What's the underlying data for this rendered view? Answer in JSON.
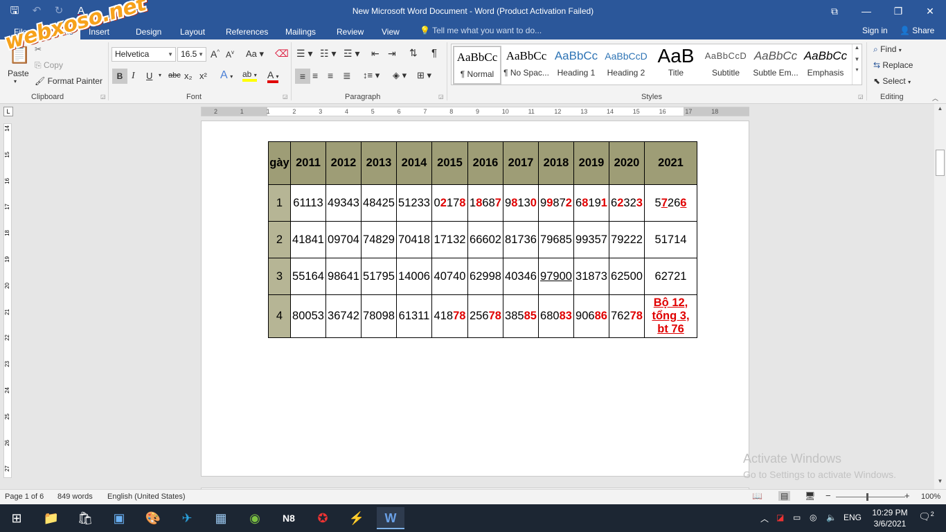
{
  "window": {
    "title": "New Microsoft Word Document  -  Word (Product Activation Failed)",
    "controls": [
      "restore-ribbon",
      "minimize",
      "maximize",
      "close"
    ]
  },
  "qat": {
    "text_icon": "A"
  },
  "tabs": [
    "File",
    "Home",
    "Insert",
    "Design",
    "Layout",
    "References",
    "Mailings",
    "Review",
    "View"
  ],
  "tell_me": "Tell me what you want to do...",
  "account": {
    "signin": "Sign in",
    "share": "Share"
  },
  "watermark_logo": "webxoso.net",
  "ribbon": {
    "clipboard": {
      "label": "Clipboard",
      "paste": "Paste",
      "copy": "Copy",
      "format_painter": "Format Painter"
    },
    "font": {
      "label": "Font",
      "family": "Helvetica",
      "size": "16.5",
      "grow": "A",
      "shrink": "A",
      "case": "Aa",
      "bold": "B",
      "italic": "I",
      "underline": "U",
      "strike": "abc",
      "sub": "x₂",
      "sup": "x²",
      "effects": "A",
      "highlight": "ab",
      "font_color": "A"
    },
    "paragraph": {
      "label": "Paragraph",
      "pilcrow": "¶"
    },
    "styles": {
      "label": "Styles",
      "items": [
        {
          "preview": "AaBbCc",
          "name": "¶ Normal"
        },
        {
          "preview": "AaBbCc",
          "name": "¶ No Spac..."
        },
        {
          "preview": "AaBbCc",
          "name": "Heading 1"
        },
        {
          "preview": "AaBbCcD",
          "name": "Heading 2"
        },
        {
          "preview": "AaB",
          "name": "Title"
        },
        {
          "preview": "AaBbCcD",
          "name": "Subtitle"
        },
        {
          "preview": "AaBbCc",
          "name": "Subtle Em..."
        },
        {
          "preview": "AaBbCc",
          "name": "Emphasis"
        }
      ]
    },
    "editing": {
      "label": "Editing",
      "find": "Find",
      "replace": "Replace",
      "select": "Select"
    }
  },
  "ruler": {
    "h_ticks": [
      "2",
      "1",
      "1",
      "2",
      "3",
      "4",
      "5",
      "6",
      "7",
      "8",
      "9",
      "10",
      "11",
      "12",
      "13",
      "14",
      "15",
      "16",
      "17",
      "18"
    ],
    "v_ticks": [
      "14",
      "15",
      "16",
      "17",
      "18",
      "19",
      "20",
      "21",
      "22",
      "23",
      "24",
      "25",
      "26",
      "27"
    ]
  },
  "table": {
    "headers": [
      "gày",
      "2011",
      "2012",
      "2013",
      "2014",
      "2015",
      "2016",
      "2017",
      "2018",
      "2019",
      "2020",
      "2021"
    ],
    "rows": [
      {
        "idx": "1",
        "cells": [
          [
            {
              "t": "61113"
            }
          ],
          [
            {
              "t": "49343"
            }
          ],
          [
            {
              "t": "48425"
            }
          ],
          [
            {
              "t": "51233"
            }
          ],
          [
            {
              "t": "0"
            },
            {
              "t": "2",
              "red": true
            },
            {
              "t": "17"
            },
            {
              "t": "8",
              "red": true
            }
          ],
          [
            {
              "t": "1"
            },
            {
              "t": "8",
              "red": true
            },
            {
              "t": "68"
            },
            {
              "t": "7",
              "red": true
            }
          ],
          [
            {
              "t": "9"
            },
            {
              "t": "8",
              "red": true
            },
            {
              "t": "13"
            },
            {
              "t": "0",
              "red": true
            }
          ],
          [
            {
              "t": "9"
            },
            {
              "t": "9",
              "red": true
            },
            {
              "t": "87"
            },
            {
              "t": "2",
              "red": true
            }
          ],
          [
            {
              "t": "6"
            },
            {
              "t": "8",
              "red": true
            },
            {
              "t": "19"
            },
            {
              "t": "1",
              "red": true
            }
          ],
          [
            {
              "t": "6"
            },
            {
              "t": "2",
              "red": true
            },
            {
              "t": "32"
            },
            {
              "t": "3",
              "red": true
            }
          ],
          [
            {
              "t": "5"
            },
            {
              "t": "7",
              "red": true,
              "ul": true
            },
            {
              "t": "26"
            },
            {
              "t": "6",
              "red": true,
              "ul": true
            }
          ]
        ]
      },
      {
        "idx": "2",
        "cells": [
          [
            {
              "t": "41841"
            }
          ],
          [
            {
              "t": "09704"
            }
          ],
          [
            {
              "t": "74829"
            }
          ],
          [
            {
              "t": "70418"
            }
          ],
          [
            {
              "t": "17132"
            }
          ],
          [
            {
              "t": "66602"
            }
          ],
          [
            {
              "t": "81736"
            }
          ],
          [
            {
              "t": "79685"
            }
          ],
          [
            {
              "t": "99357"
            }
          ],
          [
            {
              "t": "79222"
            }
          ],
          [
            {
              "t": "51714"
            }
          ]
        ]
      },
      {
        "idx": "3",
        "cells": [
          [
            {
              "t": "55164"
            }
          ],
          [
            {
              "t": "98641"
            }
          ],
          [
            {
              "t": "51795"
            }
          ],
          [
            {
              "t": "14006"
            }
          ],
          [
            {
              "t": "40740"
            }
          ],
          [
            {
              "t": "62998"
            }
          ],
          [
            {
              "t": "40346"
            }
          ],
          [
            {
              "t": "97900",
              "ul": true
            }
          ],
          [
            {
              "t": "31873"
            }
          ],
          [
            {
              "t": "62500"
            }
          ],
          [
            {
              "t": "62721"
            }
          ]
        ]
      },
      {
        "idx": "4",
        "cells": [
          [
            {
              "t": "80053"
            }
          ],
          [
            {
              "t": "36742"
            }
          ],
          [
            {
              "t": "78098"
            }
          ],
          [
            {
              "t": "61311"
            }
          ],
          [
            {
              "t": "418"
            },
            {
              "t": "78",
              "red": true
            }
          ],
          [
            {
              "t": "256"
            },
            {
              "t": "78",
              "red": true
            }
          ],
          [
            {
              "t": "385"
            },
            {
              "t": "85",
              "red": true
            }
          ],
          [
            {
              "t": "680"
            },
            {
              "t": "83",
              "red": true
            }
          ],
          [
            {
              "t": "906"
            },
            {
              "t": "86",
              "red": true
            }
          ],
          [
            {
              "t": "762"
            },
            {
              "t": "78",
              "red": true
            }
          ],
          [
            {
              "t": "Bộ 12, tổng 3, bt 76",
              "red": true,
              "ul": true,
              "note": true
            }
          ]
        ]
      }
    ]
  },
  "activate": {
    "line1": "Activate Windows",
    "line2": "Go to Settings to activate Windows."
  },
  "status": {
    "page": "Page 1 of 6",
    "words": "849 words",
    "language": "English (United States)",
    "zoom": "100%",
    "zoom_minus": "−",
    "zoom_plus": "+"
  },
  "taskbar": {
    "apps": [
      "windows-start",
      "file-explorer",
      "store",
      "control-panel",
      "paint",
      "telegram",
      "calculator",
      "coccoc-browser",
      "n8",
      "garena",
      "exness",
      "word"
    ],
    "lang": "ENG",
    "time": "10:29 PM",
    "date": "3/6/2021",
    "notif_count": "2"
  }
}
